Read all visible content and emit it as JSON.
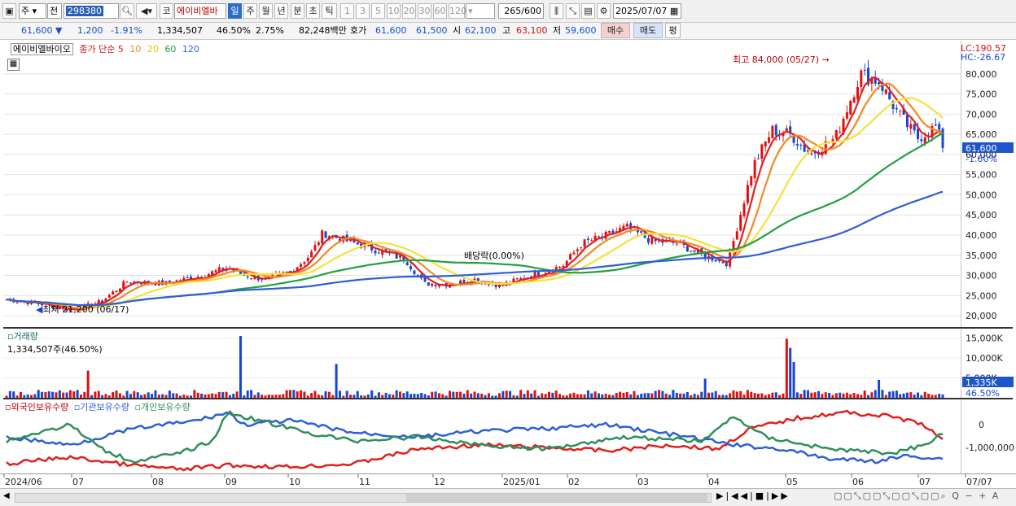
{
  "toolbar": {
    "market_type": "주",
    "period_type": "전",
    "stock_code": "298380",
    "market_btn": "코",
    "stock_name": "에이비엘바",
    "period_tabs": [
      "일",
      "주",
      "월",
      "년",
      "분",
      "초",
      "틱"
    ],
    "active_period": "일",
    "interval_btns": [
      "1",
      "3",
      "5",
      "10",
      "20",
      "30",
      "60",
      "120"
    ],
    "data_count": "265",
    "data_max": "/600",
    "date": "2025/07/07"
  },
  "quote": {
    "price": "61,600",
    "change": "1,200",
    "change_pct": "-1.91%",
    "volume": "1,334,507",
    "volume_ratio": "46.50%",
    "turnover": "2.75%",
    "amount": "82,248백만",
    "ask_label": "호가",
    "ask": "61,600",
    "bid": "61,500",
    "open_label": "시",
    "open": "62,100",
    "high_label": "고",
    "high": "63,100",
    "low_label": "저",
    "low": "59,600",
    "buy_btn": "매수",
    "sell_btn": "매도",
    "eval_btn": "평"
  },
  "price_legend": {
    "name": "에이비엘바이오",
    "label": "종가 단순",
    "ma": [
      "5",
      "10",
      "20",
      "60",
      "120"
    ],
    "ma_colors": [
      "#e02020",
      "#f08a24",
      "#f5e23a",
      "#22a040",
      "#2f5fd8"
    ]
  },
  "annotations": {
    "high": "최고 84,000 (05/27)",
    "low": "최저 21,200 (06/17)",
    "dividend": "배당락(0.00%)"
  },
  "price_axis": {
    "lc": "LC:190.57",
    "hc": "HC:-26.67",
    "ticks": [
      "80,000",
      "75,000",
      "70,000",
      "65,000",
      "60,000",
      "55,000",
      "50,000",
      "45,000",
      "40,000",
      "35,000",
      "30,000",
      "25,000",
      "20,000"
    ],
    "current": "61,600",
    "current_change": "-1.60%"
  },
  "volume_pane": {
    "title": "거래량",
    "value": "1,334,507주(46.50%)",
    "ticks": [
      "15,000K",
      "10,000K",
      "5,000K"
    ],
    "current": "1,335K",
    "current_pct": "46.50%"
  },
  "holding_pane": {
    "legend": [
      "외국인보유수량",
      "기관보유수량",
      "개인보유수량"
    ],
    "colors": [
      "#e02020",
      "#2f5fd8",
      "#2f8f5a"
    ],
    "ticks": [
      "0",
      "-1,000,000"
    ]
  },
  "date_axis": {
    "labels": [
      "2024/06",
      "07",
      "08",
      "09",
      "10",
      "11",
      "12",
      "2025/01",
      "02",
      "03",
      "04",
      "05",
      "06",
      "07",
      "07/07"
    ]
  },
  "chart_data": {
    "type": "candlestick",
    "title": "에이비엘바이오",
    "y_range": [
      18000,
      85000
    ],
    "moving_averages": [
      "5",
      "10",
      "20",
      "60",
      "120"
    ],
    "monthly_close_approx": [
      {
        "x": "2024/06",
        "y": 23500
      },
      {
        "x": "07",
        "y": 28000
      },
      {
        "x": "08",
        "y": 30000
      },
      {
        "x": "09",
        "y": 29000
      },
      {
        "x": "10",
        "y": 40000
      },
      {
        "x": "11",
        "y": 30000
      },
      {
        "x": "12",
        "y": 28000
      },
      {
        "x": "2025/01",
        "y": 32000
      },
      {
        "x": "02",
        "y": 40000
      },
      {
        "x": "03",
        "y": 38000
      },
      {
        "x": "04",
        "y": 64000
      },
      {
        "x": "05",
        "y": 62000
      },
      {
        "x": "06",
        "y": 75000
      },
      {
        "x": "07",
        "y": 61600
      }
    ],
    "high": {
      "value": 84000,
      "date": "05/27"
    },
    "low": {
      "value": 21200,
      "date": "06/17"
    },
    "volume_max_k": 15500
  }
}
